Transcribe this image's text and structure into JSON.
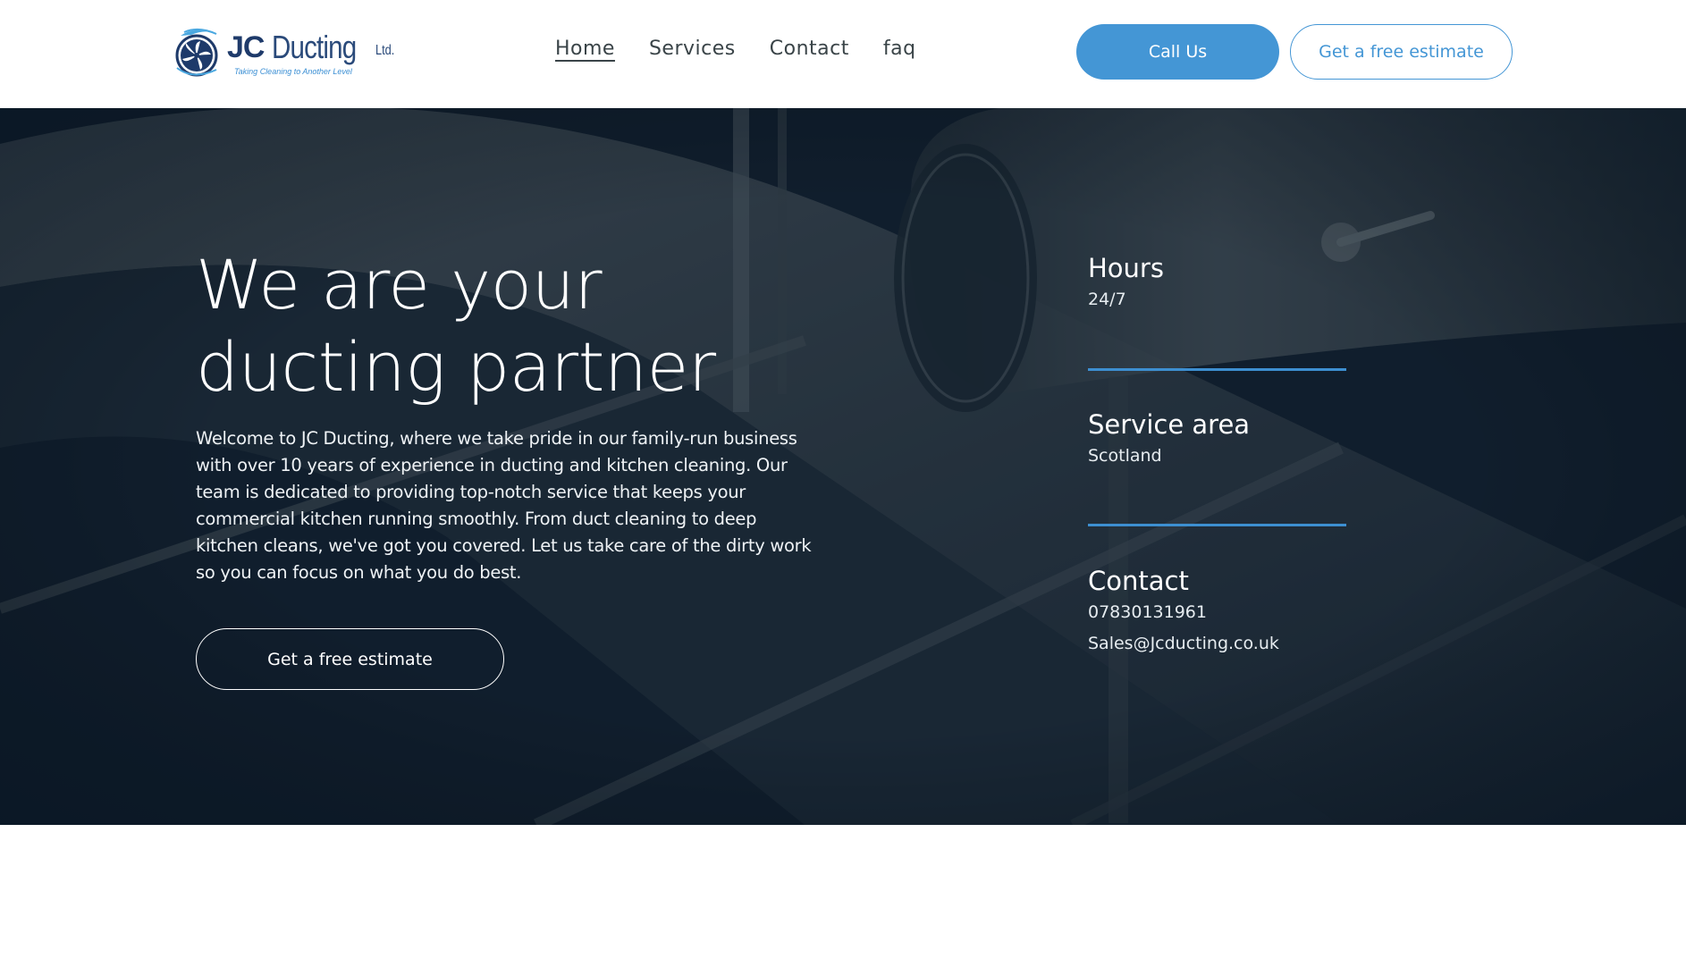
{
  "header": {
    "logo": {
      "brand_bold": "JC",
      "brand_name": "Ducting",
      "suffix": "Ltd.",
      "tagline": "Taking Cleaning to Another Level"
    },
    "nav": [
      {
        "label": "Home",
        "active": true
      },
      {
        "label": "Services",
        "active": false
      },
      {
        "label": "Contact",
        "active": false
      },
      {
        "label": "faq",
        "active": false
      }
    ],
    "call_button": "Call Us",
    "estimate_button": "Get a free estimate"
  },
  "hero": {
    "title_line1": "We are your",
    "title_line2": "ducting partner",
    "body": "Welcome to JC Ducting, where we take pride in our family-run business with over 10 years of experience in ducting and kitchen cleaning. Our team is dedicated to providing top-notch service that keeps your commercial kitchen running smoothly. From duct cleaning to deep kitchen cleans, we've got you covered. Let us take care of the dirty work so you can focus on what you do best.",
    "cta": "Get a free estimate",
    "info": {
      "hours": {
        "title": "Hours",
        "value": "24/7"
      },
      "service_area": {
        "title": "Service area",
        "value": "Scotland"
      },
      "contact": {
        "title": "Contact",
        "phone": "07830131961",
        "email": "Sales@Jcducting.co.uk"
      }
    }
  },
  "colors": {
    "accent": "#4496d5",
    "rule": "#3d8fd1",
    "brand_navy": "#1e3a6a",
    "nav_text": "#3a4448",
    "hero_dark": "#0f1c2b"
  },
  "icons": {
    "logo_mark": "fan-icon"
  }
}
